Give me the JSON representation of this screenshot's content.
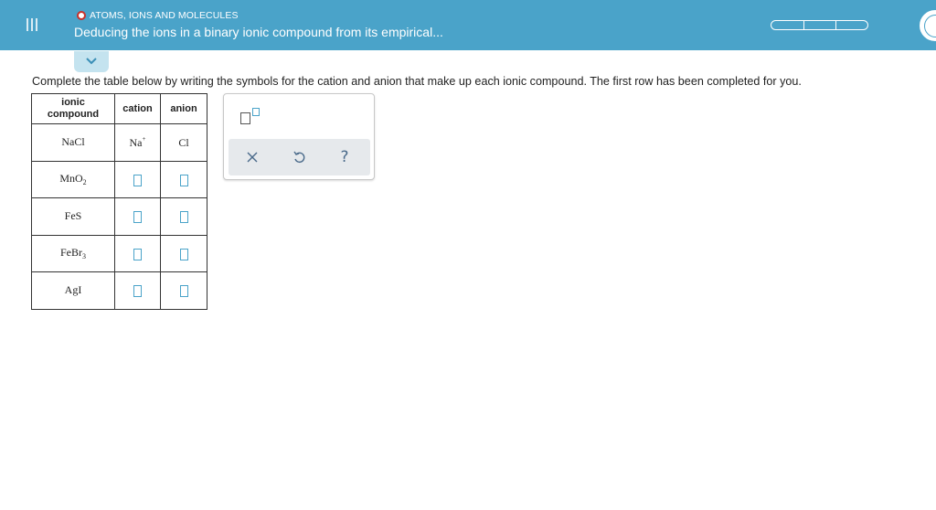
{
  "header": {
    "topic": "ATOMS, IONS AND MOLECULES",
    "title": "Deducing the ions in a binary ionic compound from its empirical...",
    "background_color": "#4aa3c9",
    "progress_segments": 3
  },
  "instructions": "Complete the table below by writing the symbols for the cation and anion that make up each ionic compound. The first row has been completed for you.",
  "table": {
    "headers": {
      "compound_line1": "ionic",
      "compound_line2": "compound",
      "cation": "cation",
      "anion": "anion"
    },
    "rows": [
      {
        "compound": "NaCl",
        "cation": "Na",
        "cation_charge": "+",
        "anion": "Cl",
        "anion_charge": ""
      },
      {
        "compound_base": "MnO",
        "compound_sub": "2",
        "cation": "",
        "anion": ""
      },
      {
        "compound": "FeS",
        "cation": "",
        "anion": ""
      },
      {
        "compound_base": "FeBr",
        "compound_sub": "3",
        "cation": "",
        "anion": ""
      },
      {
        "compound": "AgI",
        "cation": "",
        "anion": ""
      }
    ]
  },
  "palette": {
    "tools": [
      "superscript-tool"
    ],
    "actions": [
      "clear-icon",
      "undo-icon",
      "help-icon"
    ],
    "help_label": "?"
  },
  "icons": {
    "menu": "hamburger-icon",
    "collapse": "chevron-down-icon",
    "topic_status": "status-dot-icon"
  }
}
